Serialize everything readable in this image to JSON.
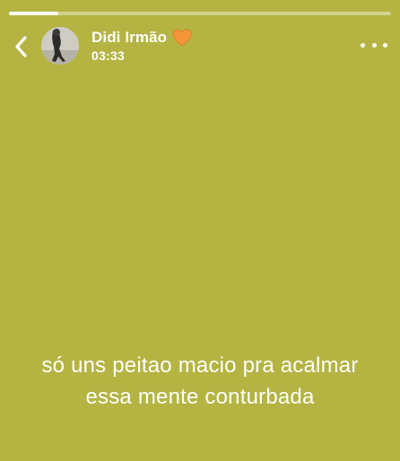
{
  "story": {
    "background_color": "#b5b443",
    "progress_fraction": 0.13
  },
  "header": {
    "back_icon": "chevron-left-icon",
    "user_name": "Didi Irmão",
    "heart_icon": "orange-heart-icon",
    "heart_color": "#f5953a",
    "timestamp": "03:33",
    "more_icon": "more-horizontal-icon"
  },
  "caption": {
    "lines": [
      "só uns peitao macio pra acalmar",
      "essa mente conturbada"
    ]
  }
}
